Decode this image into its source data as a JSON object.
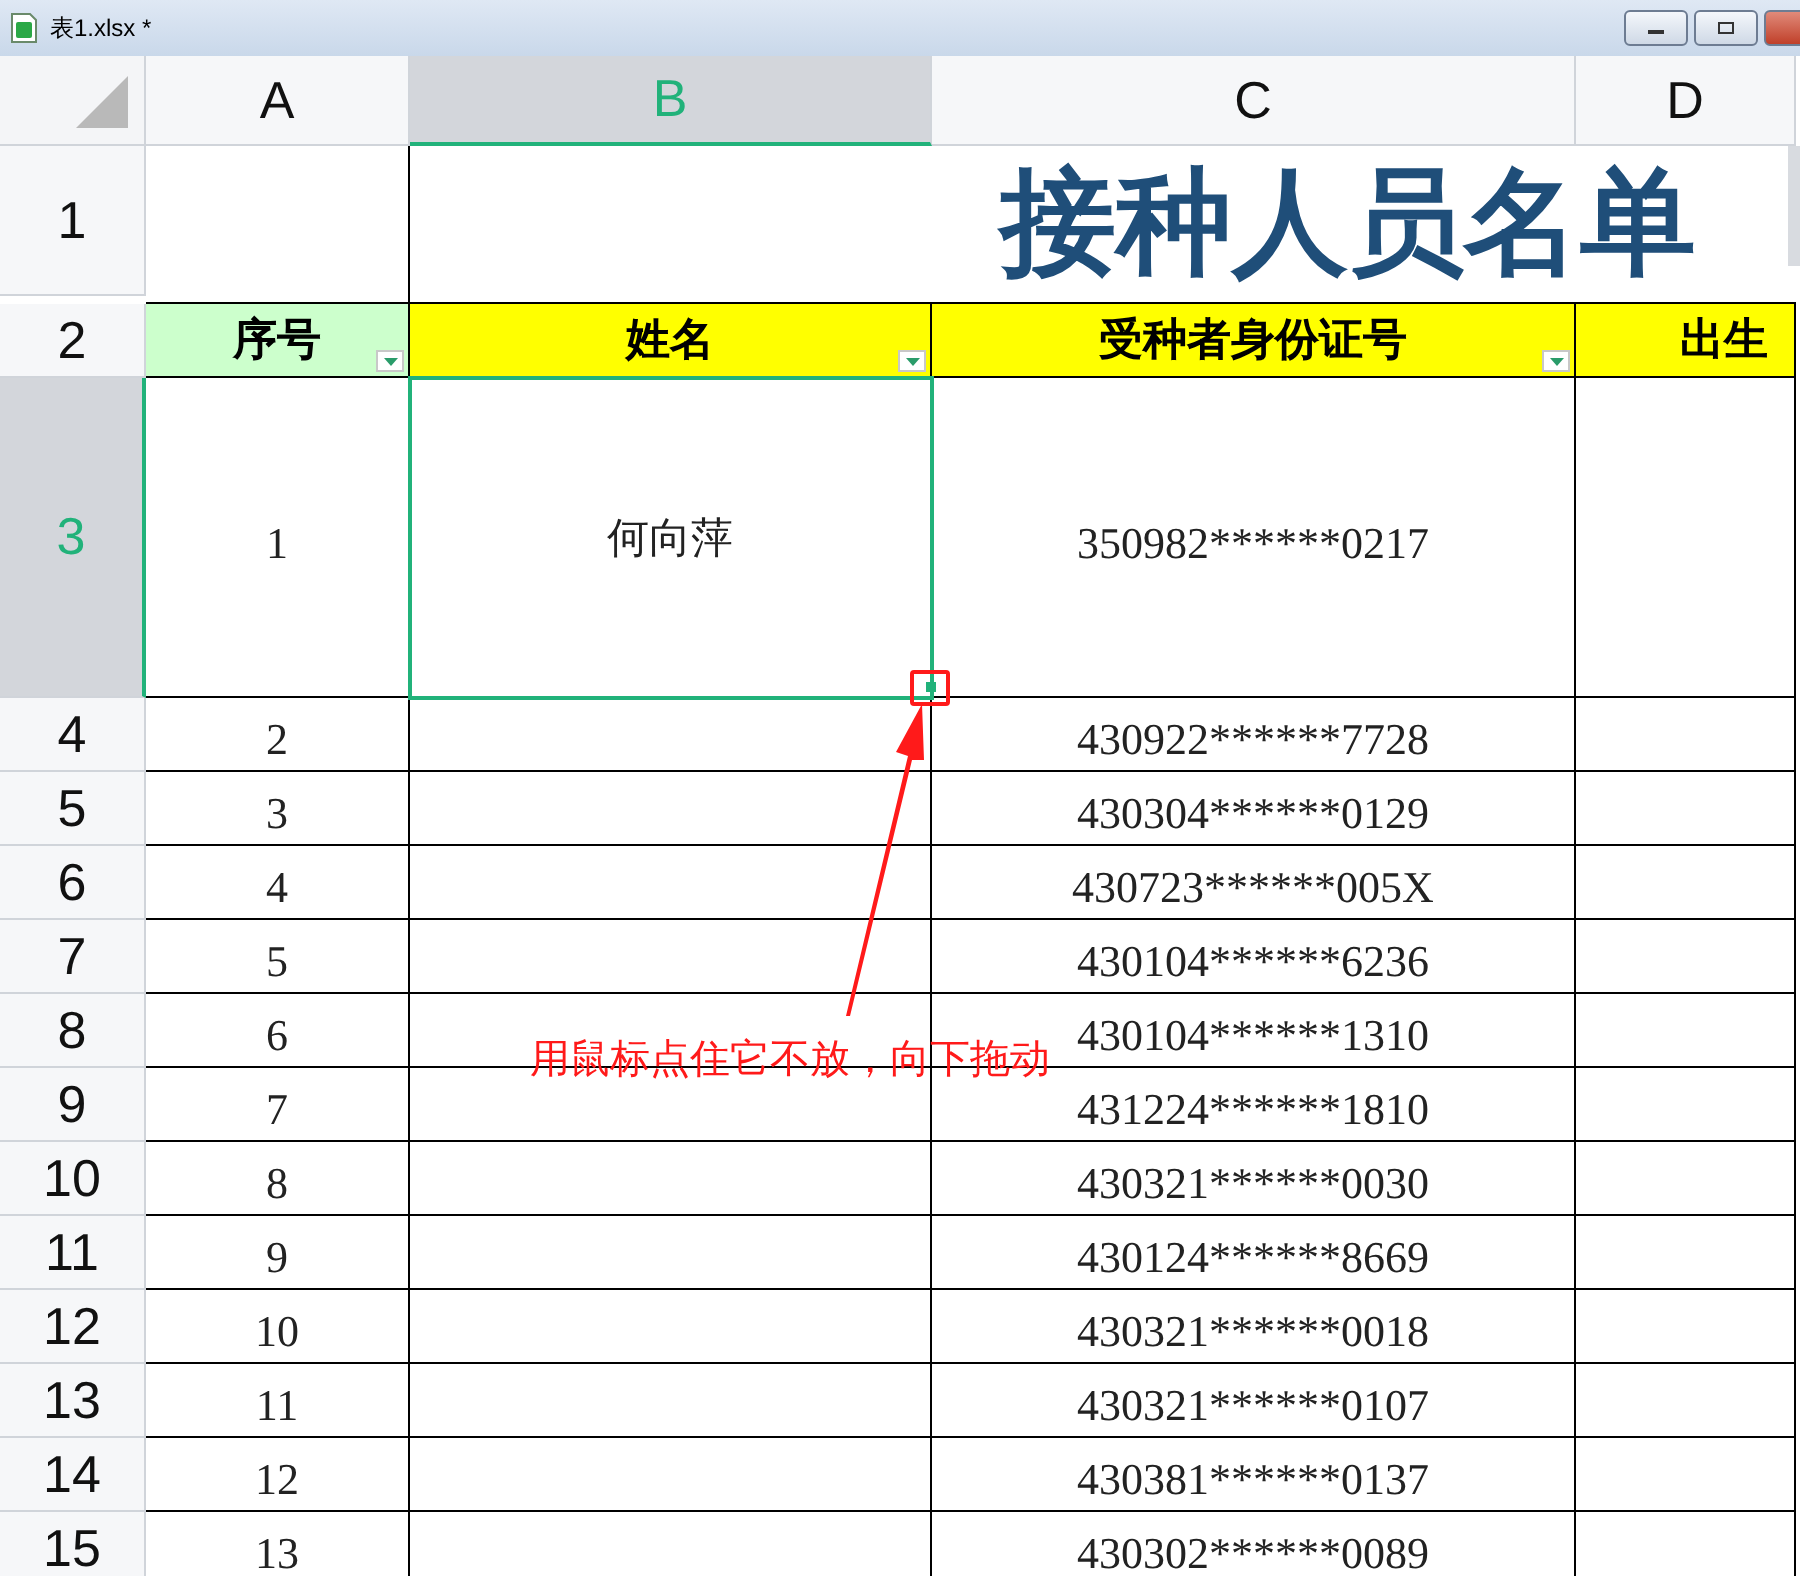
{
  "window": {
    "title": "表1.xlsx *"
  },
  "column_headers": [
    {
      "label": "A",
      "selected": false
    },
    {
      "label": "B",
      "selected": true
    },
    {
      "label": "C",
      "selected": false
    },
    {
      "label": "D",
      "selected": false
    }
  ],
  "title_row": {
    "number": "1",
    "title": "接种人员名单"
  },
  "header_row": {
    "number": "2",
    "cells": [
      {
        "text": "序号",
        "color": "#ccffcc",
        "filter": true
      },
      {
        "text": "姓名",
        "color": "#ffff00",
        "filter": true
      },
      {
        "text": "受种者身份证号",
        "color": "#ffff00",
        "filter": true
      },
      {
        "text": "出生",
        "color": "#ffff00",
        "filter": false
      }
    ]
  },
  "rows": [
    {
      "number": "3",
      "selected": true,
      "seq": "1",
      "name": "何向萍",
      "id_number": "350982******0217"
    },
    {
      "number": "4",
      "selected": false,
      "seq": "2",
      "id_number": "430922******7728"
    },
    {
      "number": "5",
      "selected": false,
      "seq": "3",
      "id_number": "430304******0129"
    },
    {
      "number": "6",
      "selected": false,
      "seq": "4",
      "id_number": "430723******005X"
    },
    {
      "number": "7",
      "selected": false,
      "seq": "5",
      "id_number": "430104******6236"
    },
    {
      "number": "8",
      "selected": false,
      "seq": "6",
      "id_number": "430104******1310"
    },
    {
      "number": "9",
      "selected": false,
      "seq": "7",
      "id_number": "431224******1810"
    },
    {
      "number": "10",
      "selected": false,
      "seq": "8",
      "id_number": "430321******0030"
    },
    {
      "number": "11",
      "selected": false,
      "seq": "9",
      "id_number": "430124******8669"
    },
    {
      "number": "12",
      "selected": false,
      "seq": "10",
      "id_number": "430321******0018"
    },
    {
      "number": "13",
      "selected": false,
      "seq": "11",
      "id_number": "430321******0107"
    },
    {
      "number": "14",
      "selected": false,
      "seq": "12",
      "id_number": "430381******0137"
    },
    {
      "number": "15",
      "selected": false,
      "seq": "13",
      "id_number": "430302******0089"
    }
  ],
  "annotation": {
    "text": "用鼠标点住它不放，向下拖动"
  }
}
